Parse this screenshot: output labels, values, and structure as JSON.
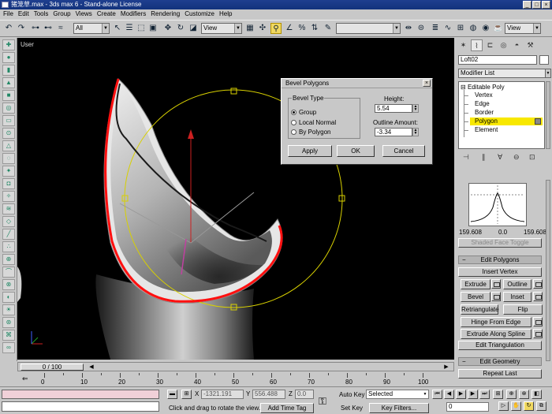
{
  "window": {
    "title": "猪笼草.max - 3ds max 6 - Stand-alone License",
    "buttons": [
      "_",
      "□",
      "×"
    ]
  },
  "menu": [
    "File",
    "Edit",
    "Tools",
    "Group",
    "Views",
    "Create",
    "Modifiers",
    "Rendering",
    "Customize",
    "Help"
  ],
  "toolbar": {
    "selection_filter": "All",
    "ref_coord": "View",
    "named_selection": "",
    "view_dropdown": "View"
  },
  "viewport": {
    "label": "User"
  },
  "dialog": {
    "title": "Bevel Polygons",
    "close": "×",
    "bevel_type_label": "Bevel Type",
    "options": [
      "Group",
      "Local Normal",
      "By Polygon"
    ],
    "selected_option": "Group",
    "height_label": "Height:",
    "height_value": "5.54",
    "outline_label": "Outline Amount:",
    "outline_value": "-3.34",
    "apply": "Apply",
    "ok": "OK",
    "cancel": "Cancel"
  },
  "command_panel": {
    "object_name": "Loft02",
    "modifier_list": "Modifier List",
    "stack": {
      "root": "Editable Poly",
      "children": [
        "Vertex",
        "Edge",
        "Border",
        "Polygon",
        "Element"
      ],
      "selected": "Polygon"
    },
    "soft_graph": {
      "left": "159.608",
      "center": "0.0",
      "right": "159.608",
      "toggle": "Shaded Face Toggle"
    },
    "edit_polygons": {
      "title": "Edit Polygons",
      "insert_vertex": "Insert Vertex",
      "extrude": "Extrude",
      "outline": "Outline",
      "bevel": "Bevel",
      "inset": "Inset",
      "retriangulate": "Retriangulate",
      "flip": "Flip",
      "hinge": "Hinge From Edge",
      "extrude_spline": "Extrude Along Spline",
      "edit_triangulation": "Edit Triangulation"
    },
    "edit_geometry": {
      "title": "Edit Geometry",
      "repeat_last": "Repeat Last"
    }
  },
  "timeline": {
    "slider": "0 / 100",
    "ticks": [
      "0",
      "10",
      "20",
      "30",
      "40",
      "50",
      "60",
      "70",
      "80",
      "90",
      "100"
    ]
  },
  "status": {
    "x_label": "X",
    "x_value": "-1321.191",
    "y_label": "Y",
    "y_value": "556.488",
    "z_label": "Z",
    "z_value": "0.0",
    "prompt": "Click and drag to rotate the view.",
    "add_time_tag": "Add Time Tag",
    "auto_key": "Auto Key",
    "selected": "Selected",
    "set_key": "Set Key",
    "key_filters": "Key Filters...",
    "frame": "0"
  }
}
